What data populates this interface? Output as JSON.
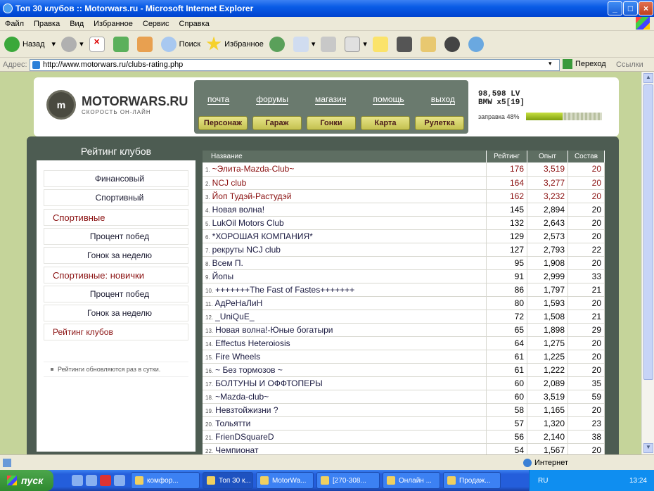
{
  "window": {
    "title": "Топ 30 клубов :: Motorwars.ru - Microsoft Internet Explorer"
  },
  "menu": [
    "Файл",
    "Правка",
    "Вид",
    "Избранное",
    "Сервис",
    "Справка"
  ],
  "toolbar": {
    "back": "Назад",
    "search": "Поиск",
    "favorites": "Избранное"
  },
  "address": {
    "label": "Адрес:",
    "url": "http://www.motorwars.ru/clubs-rating.php",
    "go": "Переход",
    "links": "Ссылки"
  },
  "site": {
    "logo": {
      "name": "MOTORWARS.RU",
      "tagline": "СКОРОСТЬ ОН-ЛАЙН"
    },
    "nav_top": [
      "почта",
      "форумы",
      "магазин",
      "помощь",
      "выход"
    ],
    "nav_buttons": [
      "Персонаж",
      "Гараж",
      "Гонки",
      "Карта",
      "Рулетка"
    ],
    "user": {
      "lv": "98,598 LV",
      "car": "BMW x5[19]",
      "fuel_label": "заправка 48%",
      "fuel": 0.48
    }
  },
  "sidebar": {
    "title": "Рейтинг клубов",
    "items": [
      {
        "label": "Финансовый"
      },
      {
        "label": "Спортивный"
      },
      {
        "label": "Спортивные"
      },
      {
        "label": "Процент побед"
      },
      {
        "label": "Гонок за неделю"
      },
      {
        "label": "Спортивные: новички"
      },
      {
        "label": "Процент побед"
      },
      {
        "label": "Гонок за неделю"
      },
      {
        "label": "Рейтинг клубов"
      }
    ],
    "note": "Рейтинги обновляются раз в сутки."
  },
  "table": {
    "headers": [
      "Название",
      "Рейтинг",
      "Опыт",
      "Состав"
    ],
    "rows": [
      {
        "n": "1.",
        "name": "~Элита-Mazda-Club~",
        "rating": "176",
        "exp": "3,519",
        "size": "20"
      },
      {
        "n": "2.",
        "name": "NCJ club",
        "rating": "164",
        "exp": "3,277",
        "size": "20"
      },
      {
        "n": "3.",
        "name": "Йоп Тудэй-Растудэй",
        "rating": "162",
        "exp": "3,232",
        "size": "20"
      },
      {
        "n": "4.",
        "name": "Новая волна!",
        "rating": "145",
        "exp": "2,894",
        "size": "20"
      },
      {
        "n": "5.",
        "name": "LukOil Motors Club",
        "rating": "132",
        "exp": "2,643",
        "size": "20"
      },
      {
        "n": "6.",
        "name": "*ХОРОШАЯ КОМПАНИЯ*",
        "rating": "129",
        "exp": "2,573",
        "size": "20"
      },
      {
        "n": "7.",
        "name": "рекруты NCJ club",
        "rating": "127",
        "exp": "2,793",
        "size": "22"
      },
      {
        "n": "8.",
        "name": "Всем П.",
        "rating": "95",
        "exp": "1,908",
        "size": "20"
      },
      {
        "n": "9.",
        "name": "Йопы",
        "rating": "91",
        "exp": "2,999",
        "size": "33"
      },
      {
        "n": "10.",
        "name": "+++++++The Fast of Fastes+++++++",
        "rating": "86",
        "exp": "1,797",
        "size": "21"
      },
      {
        "n": "11.",
        "name": "АдРеНаЛиН",
        "rating": "80",
        "exp": "1,593",
        "size": "20"
      },
      {
        "n": "12.",
        "name": "_UniQuE_",
        "rating": "72",
        "exp": "1,508",
        "size": "21"
      },
      {
        "n": "13.",
        "name": "Новая волна!-Юные богатыри",
        "rating": "65",
        "exp": "1,898",
        "size": "29"
      },
      {
        "n": "14.",
        "name": "Effectus Heteroiosis",
        "rating": "64",
        "exp": "1,275",
        "size": "20"
      },
      {
        "n": "15.",
        "name": "Fire Wheels",
        "rating": "61",
        "exp": "1,225",
        "size": "20"
      },
      {
        "n": "16.",
        "name": "~ Без тормозов ~",
        "rating": "61",
        "exp": "1,222",
        "size": "20"
      },
      {
        "n": "17.",
        "name": "БОЛТУНЫ И ОФФТОПЕРЫ",
        "rating": "60",
        "exp": "2,089",
        "size": "35"
      },
      {
        "n": "18.",
        "name": "~Mazda-club~",
        "rating": "60",
        "exp": "3,519",
        "size": "59"
      },
      {
        "n": "19.",
        "name": "Невзтойжизни ?",
        "rating": "58",
        "exp": "1,165",
        "size": "20"
      },
      {
        "n": "20.",
        "name": "Тольятти",
        "rating": "57",
        "exp": "1,320",
        "size": "23"
      },
      {
        "n": "21.",
        "name": "FrienDSquareD",
        "rating": "56",
        "exp": "2,140",
        "size": "38"
      },
      {
        "n": "22.",
        "name": "Чемпионат",
        "rating": "54",
        "exp": "1,567",
        "size": "20"
      }
    ]
  },
  "status": {
    "zone": "Интернет"
  },
  "taskbar": {
    "start": "пуск",
    "tasks": [
      "комфор...",
      "Топ 30 к...",
      "MotorWa...",
      "[270-308...",
      "Онлайн ...",
      "Продаж..."
    ],
    "lang": "RU",
    "time": "13:24"
  }
}
